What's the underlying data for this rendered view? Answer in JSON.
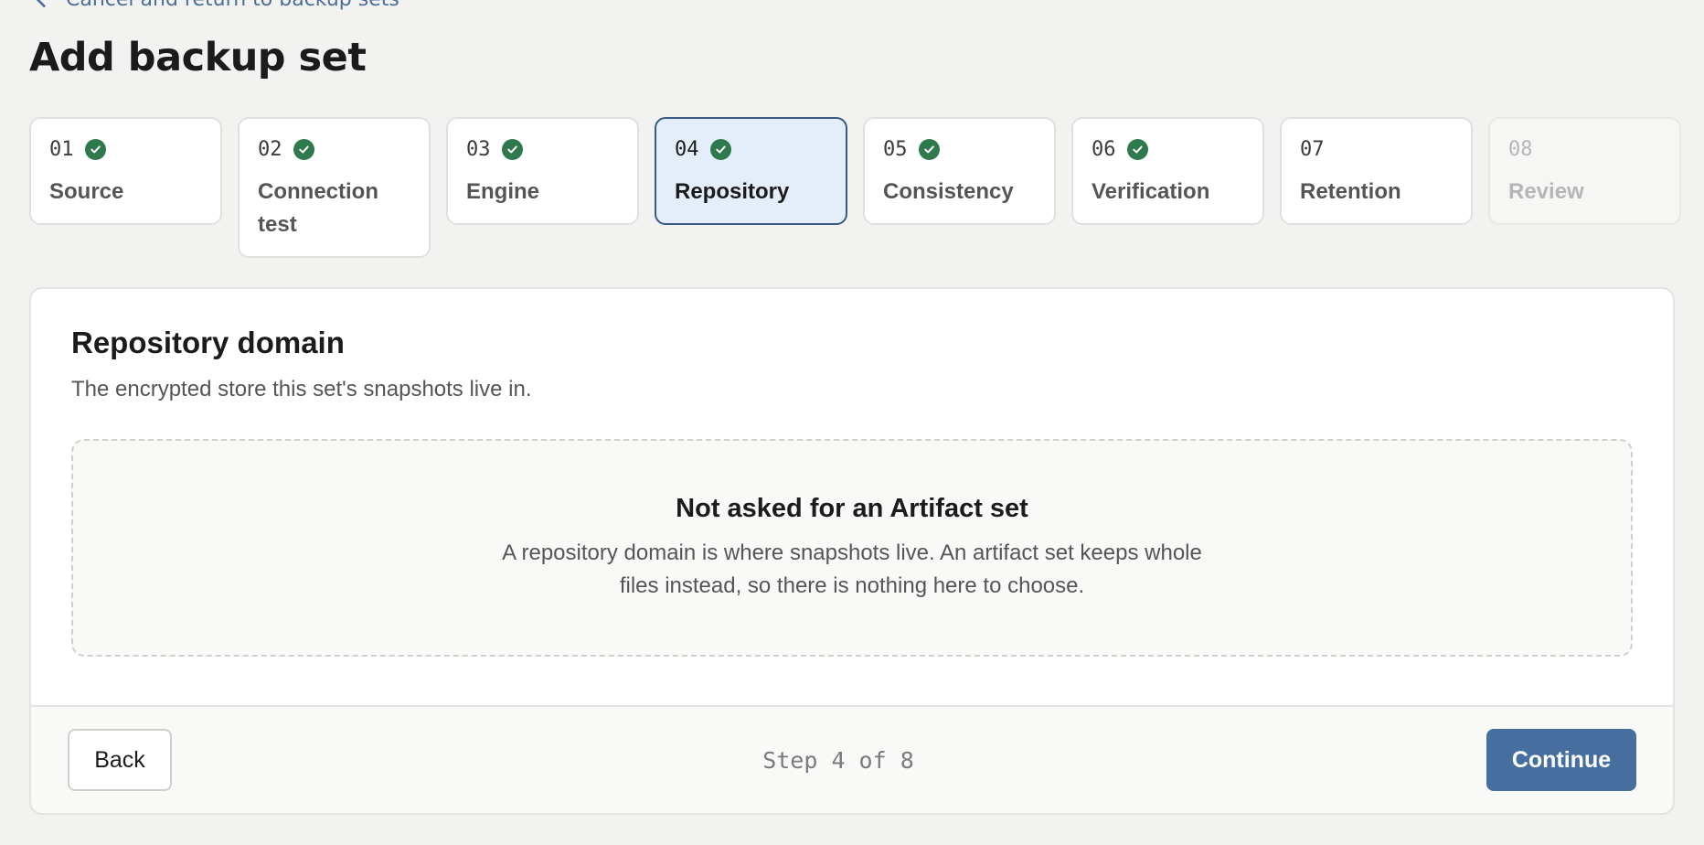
{
  "nav": {
    "back_link_label": "Cancel and return to backup sets"
  },
  "page": {
    "title": "Add backup set"
  },
  "steps": [
    {
      "num": "01",
      "label": "Source",
      "state": "complete"
    },
    {
      "num": "02",
      "label": "Connection test",
      "state": "complete"
    },
    {
      "num": "03",
      "label": "Engine",
      "state": "complete"
    },
    {
      "num": "04",
      "label": "Repository",
      "state": "active-complete"
    },
    {
      "num": "05",
      "label": "Consistency",
      "state": "complete"
    },
    {
      "num": "06",
      "label": "Verification",
      "state": "complete"
    },
    {
      "num": "07",
      "label": "Retention",
      "state": "pending"
    },
    {
      "num": "08",
      "label": "Review",
      "state": "disabled"
    }
  ],
  "section": {
    "title": "Repository domain",
    "description": "The encrypted store this set's snapshots live in."
  },
  "empty_state": {
    "title": "Not asked for an Artifact set",
    "text": "A repository domain is where snapshots live. An artifact set keeps whole files instead, so there is nothing here to choose."
  },
  "footer": {
    "back_label": "Back",
    "step_count": "Step 4 of 8",
    "continue_label": "Continue"
  },
  "colors": {
    "accent": "#466e9e",
    "active_step_bg": "#e4eefa",
    "active_step_border": "#365a85",
    "complete_check": "#2f7a4d",
    "link": "#4b6e99"
  },
  "icons": {
    "back": "chevron-left-icon",
    "complete": "check-circle-icon"
  }
}
